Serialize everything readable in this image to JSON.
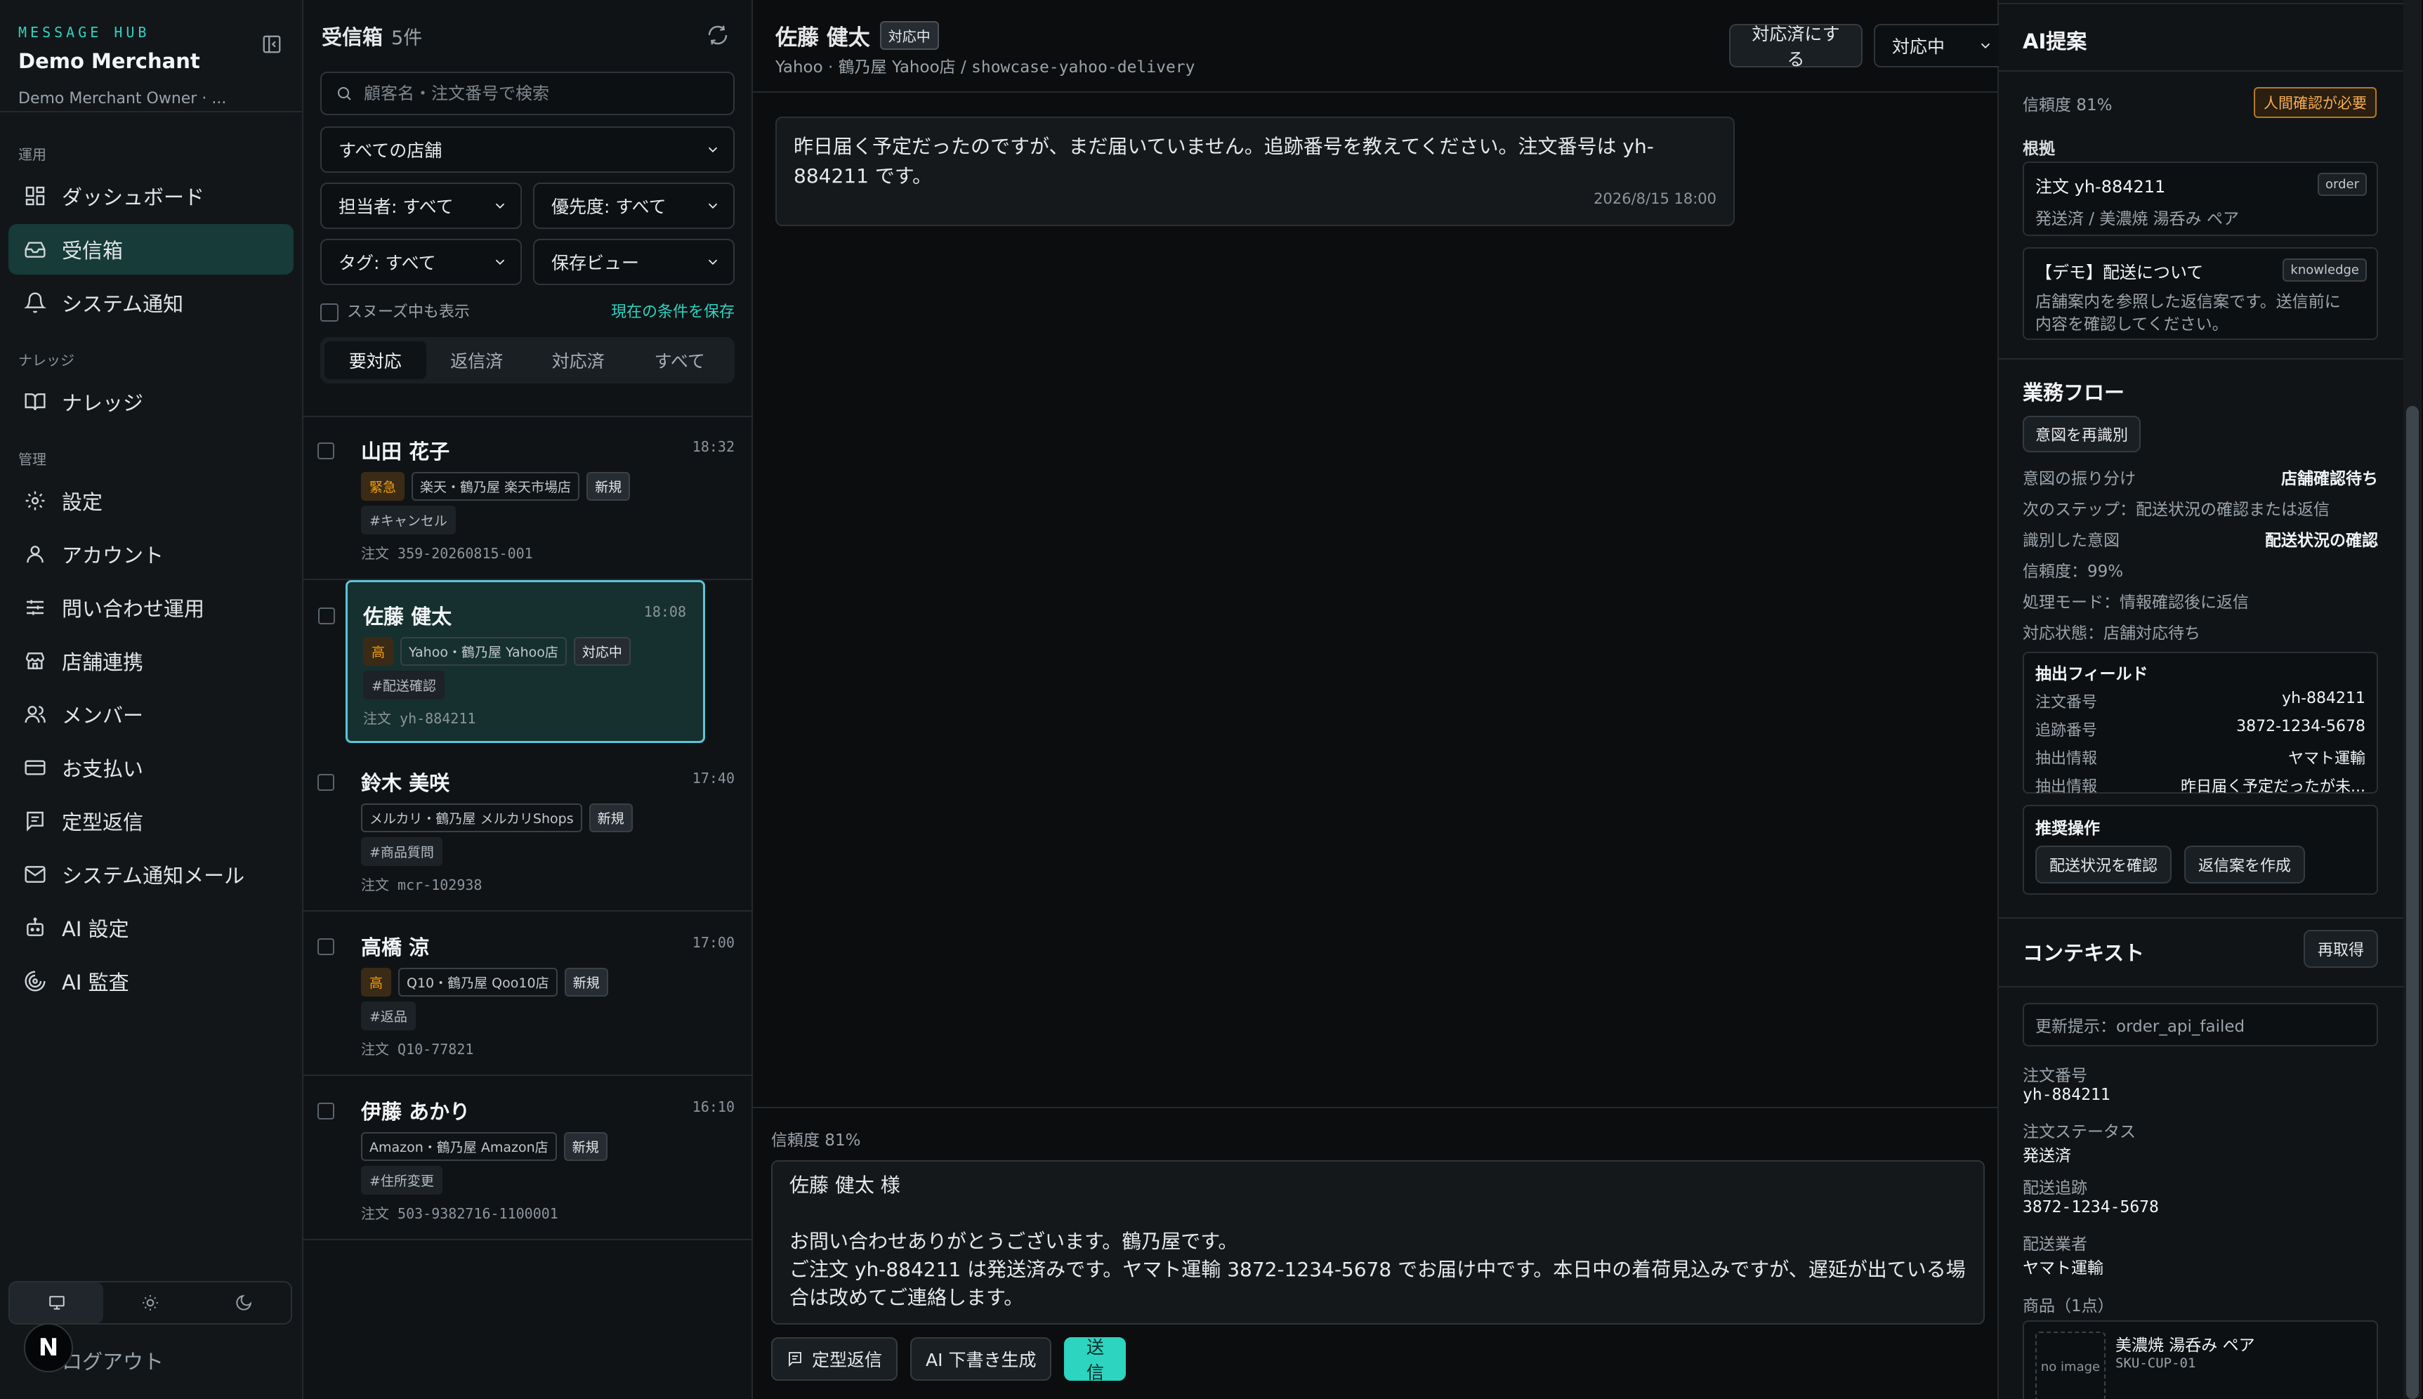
{
  "sidebar": {
    "kicker": "MESSAGE HUB",
    "merchant": "Demo Merchant",
    "owner": "Demo Merchant Owner · ...",
    "sections": [
      {
        "label": "運用",
        "items": [
          {
            "label": "ダッシュボード",
            "icon": "dashboard-icon"
          },
          {
            "label": "受信箱",
            "icon": "inbox-icon",
            "active": true
          },
          {
            "label": "システム通知",
            "icon": "bell-icon"
          }
        ]
      },
      {
        "label": "ナレッジ",
        "items": [
          {
            "label": "ナレッジ",
            "icon": "book-icon"
          }
        ]
      },
      {
        "label": "管理",
        "items": [
          {
            "label": "設定",
            "icon": "gear-icon"
          },
          {
            "label": "アカウント",
            "icon": "user-icon"
          },
          {
            "label": "問い合わせ運用",
            "icon": "sliders-icon"
          },
          {
            "label": "店舗連携",
            "icon": "store-icon"
          },
          {
            "label": "メンバー",
            "icon": "users-icon"
          },
          {
            "label": "お支払い",
            "icon": "credit-card-icon"
          },
          {
            "label": "定型返信",
            "icon": "template-icon"
          },
          {
            "label": "システム通知メール",
            "icon": "mail-icon"
          },
          {
            "label": "AI 設定",
            "icon": "bot-icon"
          },
          {
            "label": "AI 監査",
            "icon": "audit-icon"
          }
        ]
      }
    ],
    "logout": "ログアウト",
    "avatar_letter": "N"
  },
  "inbox": {
    "title": "受信箱",
    "count": "5件",
    "search_placeholder": "顧客名・注文番号で検索",
    "store_filter": "すべての店舗",
    "assignee_filter": "担当者: すべて",
    "priority_filter": "優先度: すべて",
    "tag_filter": "タグ: すべて",
    "saved_view": "保存ビュー",
    "snooze_label": "スヌーズ中も表示",
    "save_condition": "現在の条件を保存",
    "tabs": [
      "要対応",
      "返信済",
      "対応済",
      "すべて"
    ],
    "order_label": "注文",
    "items": [
      {
        "name": "山田 花子",
        "time": "18:32",
        "priority": "緊急",
        "store": "楽天・鶴乃屋 楽天市場店",
        "status": "新規",
        "hashtag": "#キャンセル",
        "order": "359-20260815-001"
      },
      {
        "name": "佐藤 健太",
        "time": "18:08",
        "priority": "高",
        "store": "Yahoo・鶴乃屋 Yahoo店",
        "status": "対応中",
        "hashtag": "#配送確認",
        "order": "yh-884211"
      },
      {
        "name": "鈴木 美咲",
        "time": "17:40",
        "priority": "",
        "store": "メルカリ・鶴乃屋 メルカリShops",
        "status": "新規",
        "hashtag": "#商品質問",
        "order": "mcr-102938"
      },
      {
        "name": "高橋 涼",
        "time": "17:00",
        "priority": "高",
        "store": "Q10・鶴乃屋 Qoo10店",
        "status": "新規",
        "hashtag": "#返品",
        "order": "Q10-77821"
      },
      {
        "name": "伊藤 あかり",
        "time": "16:10",
        "priority": "",
        "store": "Amazon・鶴乃屋 Amazon店",
        "status": "新規",
        "hashtag": "#住所変更",
        "order": "503-9382716-1100001"
      }
    ]
  },
  "conversation": {
    "customer": "佐藤 健太",
    "status_badge": "対応中",
    "channel": "Yahoo · 鶴乃屋 Yahoo店 / ",
    "slug": "showcase-yahoo-delivery",
    "mark_done": "対応済にする",
    "status_select": "対応中",
    "message_line1": "昨日届く予定だったのですが、まだ届いていません。追跡番号を教えてください。注文番号は yh-",
    "message_line2": "884211 です。",
    "message_time": "2026/8/15 18:00",
    "confidence": "信頼度 81%",
    "reply": "佐藤 健太 様\n\nお問い合わせありがとうございます。鶴乃屋です。\nご注文 yh-884211 は発送済みです。ヤマト運輸 3872-1234-5678 でお届け中です。本日中の着荷見込みですが、遅延が出ている場\n合は改めてご連絡します。",
    "btn_template": "定型返信",
    "btn_ai": "AI 下書き生成",
    "btn_send": "送信"
  },
  "ai_panel": {
    "title": "AI提案",
    "confidence": "信頼度 81%",
    "review_badge": "人間確認が必要",
    "basis_title": "根拠",
    "basis": [
      {
        "title": "注文 yh-884211",
        "tag": "order",
        "body": "発送済 / 美濃焼 湯呑み ペア"
      },
      {
        "title": "【デモ】配送について",
        "tag": "knowledge",
        "body1": "店舗案内を参照した返信案です。送信前に",
        "body2": "内容を確認してください。"
      }
    ],
    "flow_title": "業務フロー",
    "reidentify": "意図を再識別",
    "flow": [
      {
        "k": "意図の振り分け",
        "v": "店舗確認待ち"
      },
      {
        "k": "次のステップ：配送状況の確認または返信",
        "v": ""
      },
      {
        "k": "識別した意図",
        "v": "配送状況の確認"
      },
      {
        "k": "信頼度：99%",
        "v": ""
      },
      {
        "k": "処理モード：情報確認後に返信",
        "v": ""
      },
      {
        "k": "対応状態：店舗対応待ち",
        "v": ""
      }
    ],
    "fields_title": "抽出フィールド",
    "fields": [
      {
        "k": "注文番号",
        "v": "yh-884211"
      },
      {
        "k": "追跡番号",
        "v": "3872-1234-5678"
      },
      {
        "k": "抽出情報",
        "v": "ヤマト運輸"
      },
      {
        "k": "抽出情報",
        "v": "昨日届く予定だったが未..."
      }
    ],
    "recommend_title": "推奨操作",
    "recommend": [
      "配送状況を確認",
      "返信案を作成"
    ]
  },
  "context": {
    "title": "コンテキスト",
    "refetch": "再取得",
    "update_hint": "更新提示：order_api_failed",
    "items": [
      {
        "k": "注文番号",
        "v": "yh-884211"
      },
      {
        "k": "注文ステータス",
        "v": "発送済"
      },
      {
        "k": "配送追跡",
        "v": "3872-1234-5678"
      },
      {
        "k": "配送業者",
        "v": "ヤマト運輸"
      }
    ],
    "products_label": "商品（1点）",
    "product_name": "美濃焼 湯呑み ペア",
    "product_sku": "SKU-CUP-01",
    "no_image": "no image"
  }
}
